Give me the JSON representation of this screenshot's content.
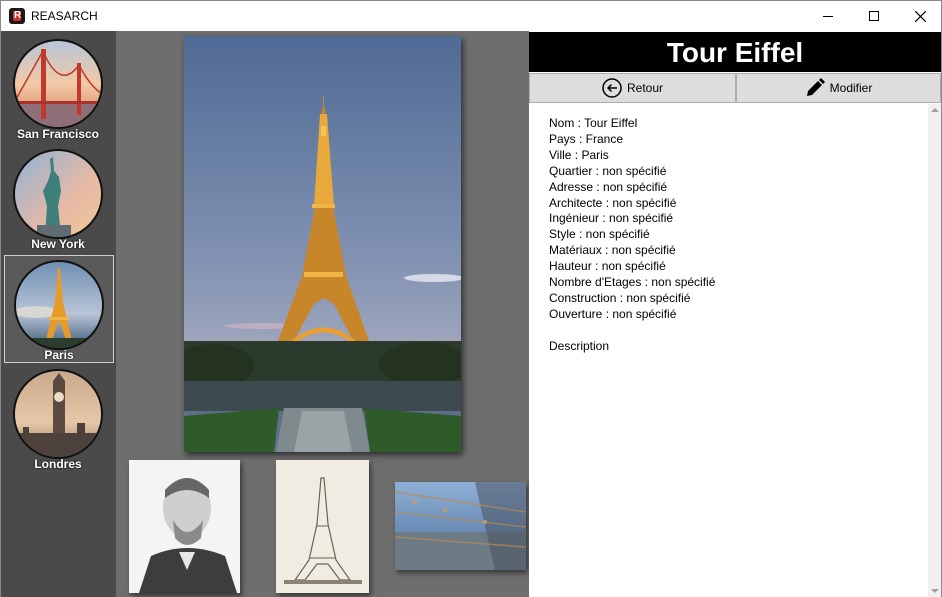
{
  "window": {
    "title": "REASARCH",
    "icon": "app-logo-icon"
  },
  "sidebar": {
    "items": [
      {
        "label": "San Francisco",
        "image": "golden-gate-bridge",
        "selected": false
      },
      {
        "label": "New York",
        "image": "statue-of-liberty",
        "selected": false
      },
      {
        "label": "Paris",
        "image": "eiffel-tower",
        "selected": true
      },
      {
        "label": "Londres",
        "image": "big-ben",
        "selected": false
      }
    ]
  },
  "gallery": {
    "main_image": "eiffel-tower-dusk",
    "thumbnails": [
      "gustave-eiffel-portrait",
      "eiffel-tower-engraving",
      "eiffel-tower-view-from-top"
    ]
  },
  "detail": {
    "title": "Tour Eiffel",
    "back_label": "Retour",
    "edit_label": "Modifier",
    "fields": {
      "nom": "Nom : Tour Eiffel",
      "pays": "Pays : France",
      "ville": "Ville : Paris",
      "quartier": "Quartier : non spécifié",
      "adresse": "Adresse : non spécifié",
      "architecte": "Architecte : non spécifié",
      "ingenieur": "Ingénieur : non spécifié",
      "style": "Style : non spécifié",
      "materiaux": "Matériaux : non spécifié",
      "hauteur": "Hauteur : non spécifié",
      "etages": "Nombre d'Etages : non spécifié",
      "construction": "Construction : non spécifié",
      "ouverture": "Ouverture : non spécifié"
    },
    "description_label": "Description"
  },
  "colors": {
    "sidebar_bg": "#4a4a4a",
    "gallery_bg": "#6e6e6e",
    "title_bg": "#000000",
    "button_bg": "#dddddd"
  }
}
